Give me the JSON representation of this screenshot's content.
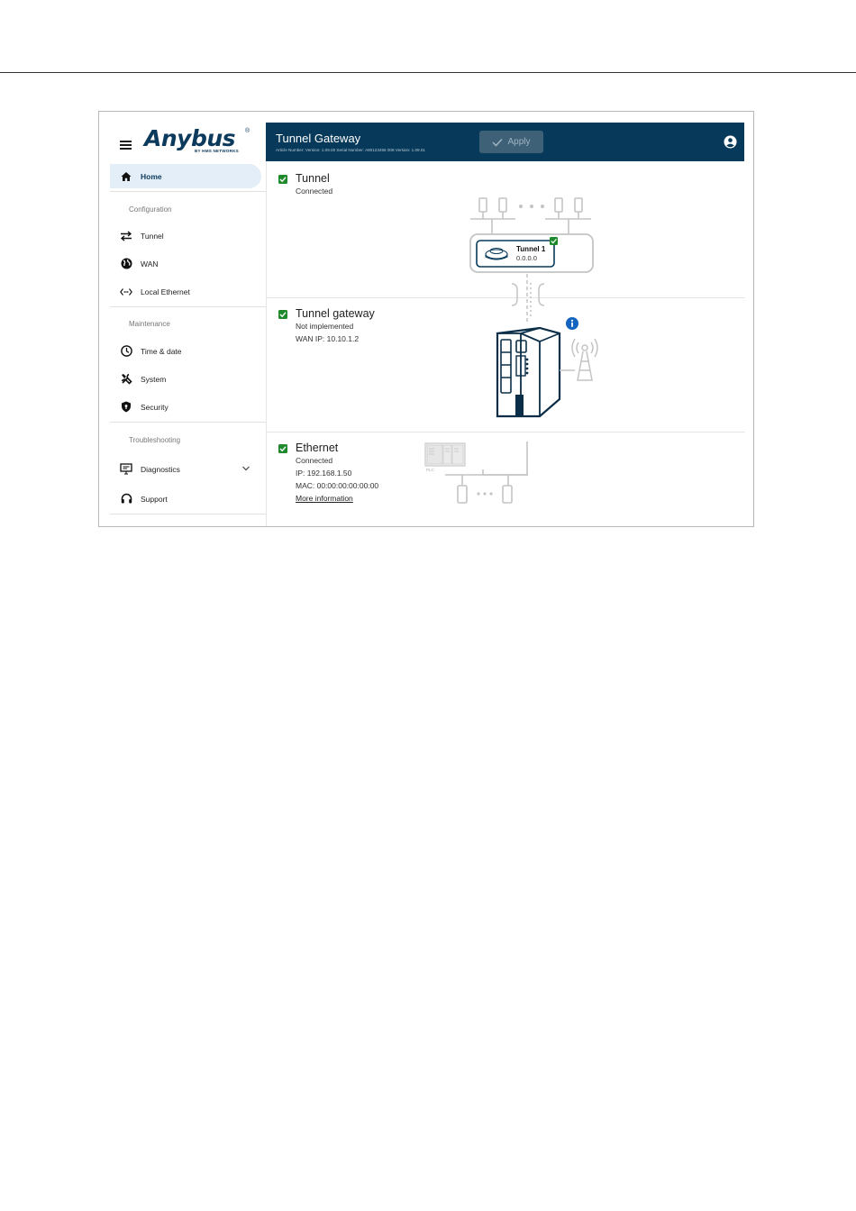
{
  "app": {
    "logo": "Anybus",
    "logo_reg": "®",
    "logo_sub": "BY HMS NETWORKS"
  },
  "header": {
    "title": "Tunnel Gateway",
    "subtitle": "Article Number: Version: 1.09.00 Serial Number: A80123456 008 Version: 1.09.01",
    "apply_label": "Apply"
  },
  "sidebar": {
    "home": "Home",
    "sections": {
      "configuration": "Configuration",
      "maintenance": "Maintenance",
      "troubleshooting": "Troubleshooting"
    },
    "items": {
      "tunnel": "Tunnel",
      "wan": "WAN",
      "local_ethernet": "Local Ethernet",
      "time_date": "Time & date",
      "system": "System",
      "security": "Security",
      "diagnostics": "Diagnostics",
      "support": "Support"
    }
  },
  "sections": {
    "tunnel": {
      "title": "Tunnel",
      "status": "Connected",
      "node_name": "Tunnel 1",
      "node_ip": "0.0.0.0"
    },
    "gateway": {
      "title": "Tunnel gateway",
      "status": "Not implemented",
      "wan_ip": "WAN IP: 10.10.1.2"
    },
    "ethernet": {
      "title": "Ethernet",
      "status": "Connected",
      "ip": "IP: 192.168.1.50",
      "mac": "MAC: 00:00:00:00:00:00",
      "more_info": "More information",
      "plc_label": "PLC"
    }
  },
  "colors": {
    "header_bg": "#073a5a",
    "brand": "#0b3a5c",
    "status_green": "#1f8a2c",
    "info_blue": "#1565c0"
  }
}
